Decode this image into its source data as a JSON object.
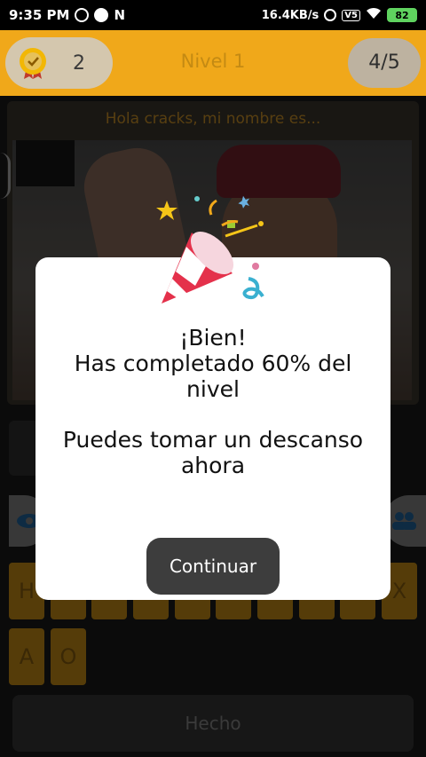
{
  "status_bar": {
    "time": "9:35 PM",
    "speed": "16.4KB/s",
    "volte": "5",
    "battery": "82"
  },
  "header": {
    "score": "2",
    "level_title": "Nivel 1",
    "progress": "4/5"
  },
  "question": {
    "text": "Hola cracks, mi nombre es..."
  },
  "keyboard": {
    "row1": [
      "H",
      "",
      "",
      "",
      "",
      "",
      "",
      "",
      "",
      "X"
    ],
    "row2": [
      "A",
      "O"
    ]
  },
  "done_label": "Hecho",
  "dialog": {
    "title_line1": "¡Bien!",
    "title_line2": "Has completado 60% del",
    "title_line3": "nivel",
    "sub_line1": "Puedes tomar un descanso",
    "sub_line2": "ahora",
    "button": "Continuar"
  },
  "colors": {
    "accent": "#f0a81a",
    "dialog_button": "#3d3d3d"
  }
}
